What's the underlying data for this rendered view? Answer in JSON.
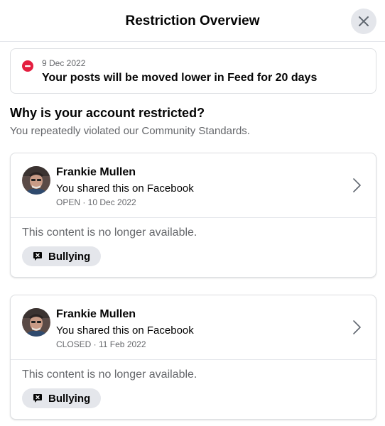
{
  "header": {
    "title": "Restriction Overview"
  },
  "banner": {
    "date": "9 Dec 2022",
    "text": "Your posts will be moved lower in Feed for 20 days",
    "icon_color": "#e41e3f"
  },
  "section": {
    "title": "Why is your account restricted?",
    "subtitle": "You repeatedly violated our Community Standards."
  },
  "cards": [
    {
      "name": "Frankie Mullen",
      "shared": "You shared this on Facebook",
      "status": "OPEN · 10 Dec 2022",
      "unavailable": "This content is no longer available.",
      "tag": "Bullying"
    },
    {
      "name": "Frankie Mullen",
      "shared": "You shared this on Facebook",
      "status": "CLOSED · 11 Feb 2022",
      "unavailable": "This content is no longer available.",
      "tag": "Bullying"
    }
  ],
  "icons": {
    "close": "close-icon",
    "restriction": "minus-circle-icon",
    "chevron": "chevron-right-icon",
    "tag": "report-flag-icon"
  },
  "colors": {
    "text_primary": "#050505",
    "text_secondary": "#65676b",
    "border": "#dddfe2",
    "chip_bg": "#e4e6eb",
    "alert_red": "#e41e3f"
  }
}
